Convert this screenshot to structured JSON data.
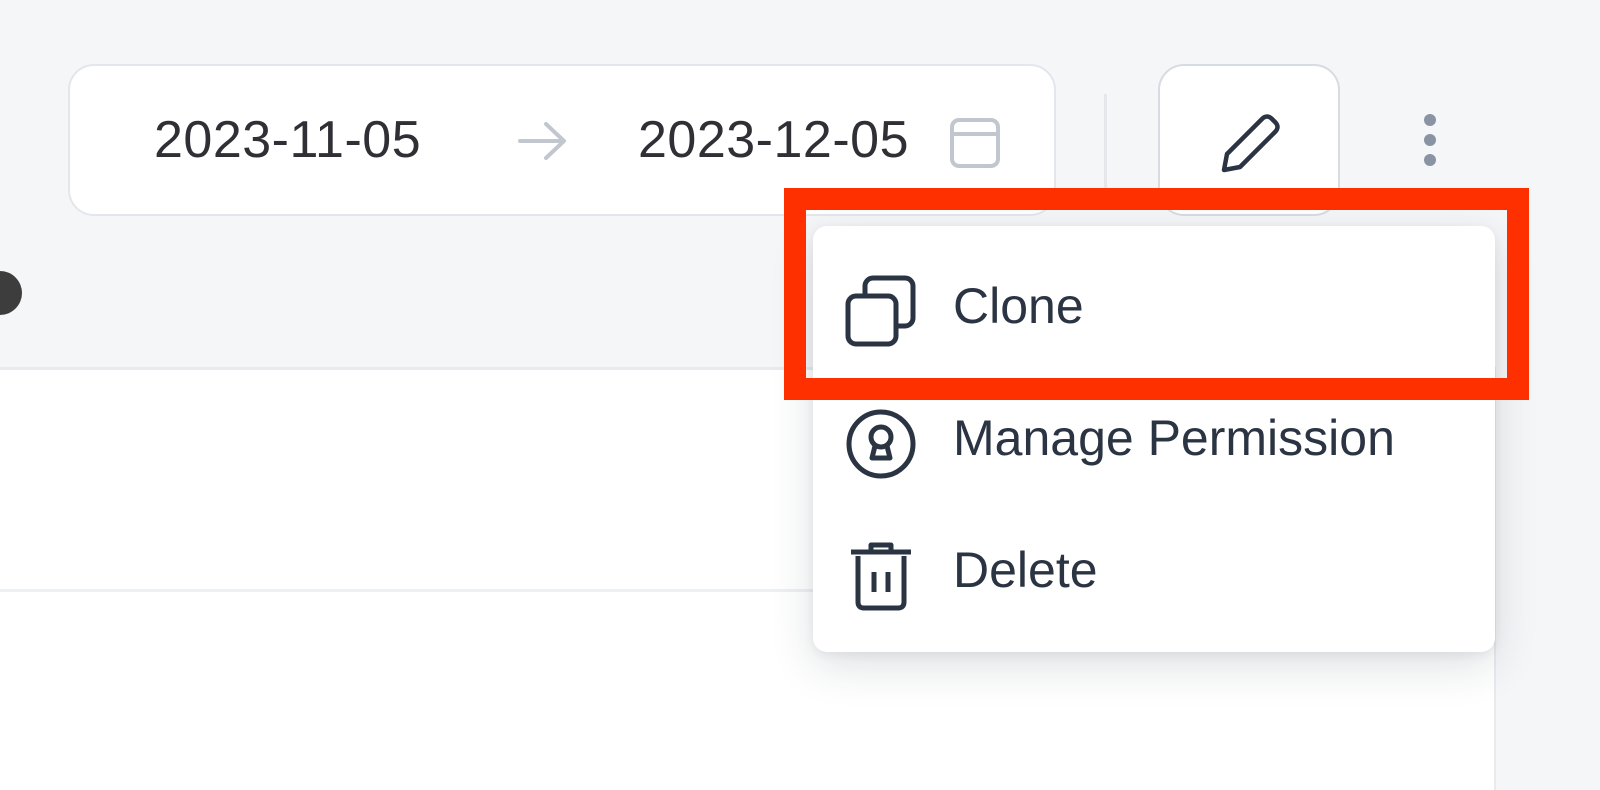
{
  "date_range": {
    "start": "2023-11-05",
    "end": "2023-12-05",
    "separator_icon": "arrow-right-icon",
    "calendar_icon": "calendar-icon"
  },
  "toolbar": {
    "edit_icon": "pencil-icon",
    "more_icon": "vertical-ellipsis-icon"
  },
  "dropdown_menu": {
    "items": [
      {
        "label": "Clone",
        "icon": "clone-icon",
        "highlighted": true
      },
      {
        "label": "Manage Permission",
        "icon": "lock-icon"
      },
      {
        "label": "Delete",
        "icon": "trash-icon"
      }
    ]
  },
  "colors": {
    "page_background": "#f5f6f8",
    "menu_text": "#2b3443",
    "highlight_border": "#ff3000",
    "muted_icon": "#c2c7cf"
  }
}
